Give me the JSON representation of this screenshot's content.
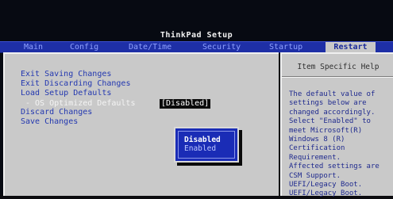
{
  "window": {
    "title": "ThinkPad Setup"
  },
  "menubar": {
    "tabs": [
      {
        "label": "Main"
      },
      {
        "label": "Config"
      },
      {
        "label": "Date/Time"
      },
      {
        "label": "Security"
      },
      {
        "label": "Startup"
      },
      {
        "label": "Restart"
      }
    ],
    "active_tab": "Restart"
  },
  "main": {
    "options": [
      {
        "label": "Exit Saving Changes"
      },
      {
        "label": "Exit Discarding Changes"
      },
      {
        "label": "Load Setup Defaults"
      },
      {
        "label": "- OS Optimized Defaults"
      },
      {
        "label": "Discard Changes"
      },
      {
        "label": "Save Changes"
      }
    ],
    "os_optimized_value": "[Disabled]"
  },
  "help": {
    "header": "Item Specific Help",
    "text": "The default value of\nsettings below are\nchanged accordingly.\nSelect \"Enabled\" to\nmeet Microsoft(R)\nWindows 8 (R)\nCertification\nRequirement.\nAffected settings are\nCSM Support.\nUEFI/Legacy Boot.\nUEFI/Legacy Boot."
  },
  "popup": {
    "options": [
      {
        "label": "Disabled"
      },
      {
        "label": "Enabled"
      }
    ],
    "selected": "Disabled"
  },
  "colors": {
    "menubar": "#1e2fa6",
    "panel": "#c9c9c9",
    "option_text": "#2338b0",
    "popup": "#1a2cb6"
  }
}
